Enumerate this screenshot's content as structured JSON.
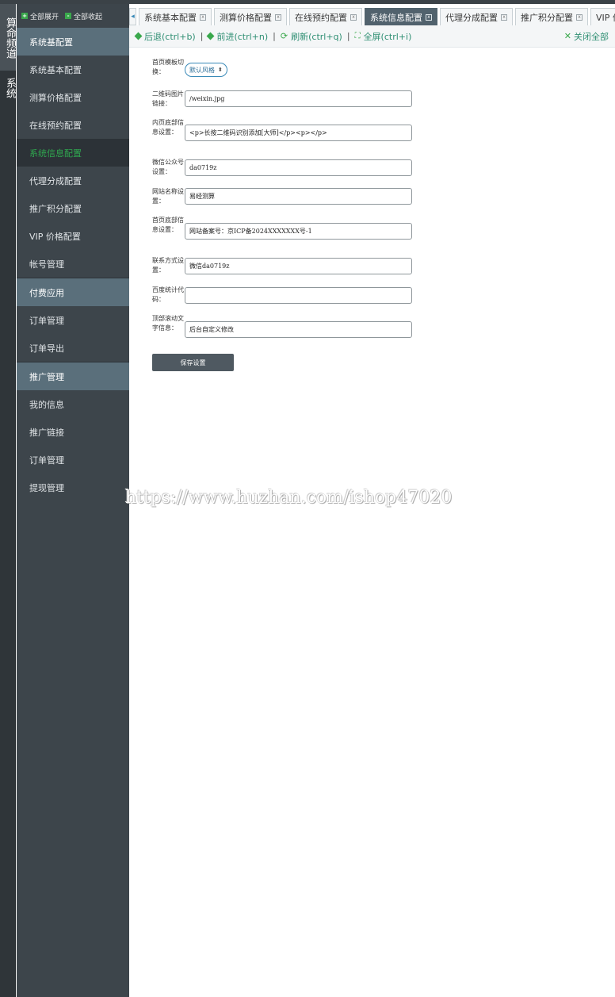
{
  "left_strip": {
    "groups": [
      {
        "label": "算命频道",
        "active": true
      },
      {
        "label": "系统",
        "active": false
      }
    ]
  },
  "sidebar": {
    "expand_all": "全部展开",
    "collapse_all": "全部收起",
    "sections": [
      {
        "header": "系统基配置",
        "items": [
          {
            "label": "系统基本配置",
            "active": false
          },
          {
            "label": "测算价格配置",
            "active": false
          },
          {
            "label": "在线预约配置",
            "active": false
          },
          {
            "label": "系统信息配置",
            "active": true
          },
          {
            "label": "代理分成配置",
            "active": false
          },
          {
            "label": "推广积分配置",
            "active": false
          },
          {
            "label": "VIP 价格配置",
            "active": false
          },
          {
            "label": "帐号管理",
            "active": false
          }
        ]
      },
      {
        "header": "付费应用",
        "items": [
          {
            "label": "订单管理",
            "active": false
          },
          {
            "label": "订单导出",
            "active": false
          }
        ]
      },
      {
        "header": "推广管理",
        "items": [
          {
            "label": "我的信息",
            "active": false
          },
          {
            "label": "推广链接",
            "active": false
          },
          {
            "label": "订单管理",
            "active": false
          },
          {
            "label": "提现管理",
            "active": false
          }
        ]
      }
    ]
  },
  "tabs": [
    {
      "label": "系统基本配置",
      "active": false
    },
    {
      "label": "测算价格配置",
      "active": false
    },
    {
      "label": "在线预约配置",
      "active": false
    },
    {
      "label": "系统信息配置",
      "active": true
    },
    {
      "label": "代理分成配置",
      "active": false
    },
    {
      "label": "推广积分配置",
      "active": false
    },
    {
      "label": "VIP 价",
      "active": false
    }
  ],
  "toolbar": {
    "back": "后退(ctrl+b)",
    "forward": "前进(ctrl+n)",
    "refresh": "刷新(ctrl+q)",
    "fullscreen": "全屏(ctrl+i)",
    "close_all": "关闭全部"
  },
  "form": {
    "template": {
      "label": "首页模板切换：",
      "value": "默认风格"
    },
    "fields": [
      {
        "label": "二维码图片链接：",
        "value": "/weixin.jpg"
      },
      {
        "label": "内页底部信息设置：",
        "value": "<p>长按二维码识别添加[大师]</p><p></p>"
      },
      {
        "label": "微信公众号设置：",
        "value": "da0719z"
      },
      {
        "label": "网站名称设置：",
        "value": "易经测算"
      },
      {
        "label": "首页底部信息设置：",
        "value": "网站备案号：京ICP备2024XXXXXXX号-1"
      },
      {
        "label": "联系方式设置：",
        "value": "微信da0719z"
      },
      {
        "label": "百度统计代码：",
        "value": ""
      },
      {
        "label": "顶部滚动文字信息：",
        "value": "后台自定义修改"
      }
    ],
    "save_label": "保存设置"
  },
  "watermark": "https://www.huzhan.com/ishop47020",
  "colors": {
    "sidebar_bg": "#3d454b",
    "section_header_bg": "#5a6f7b",
    "active_item_text": "#2fa84f",
    "active_tab_bg": "#51626d",
    "toolbar_link": "#2f8f73"
  }
}
